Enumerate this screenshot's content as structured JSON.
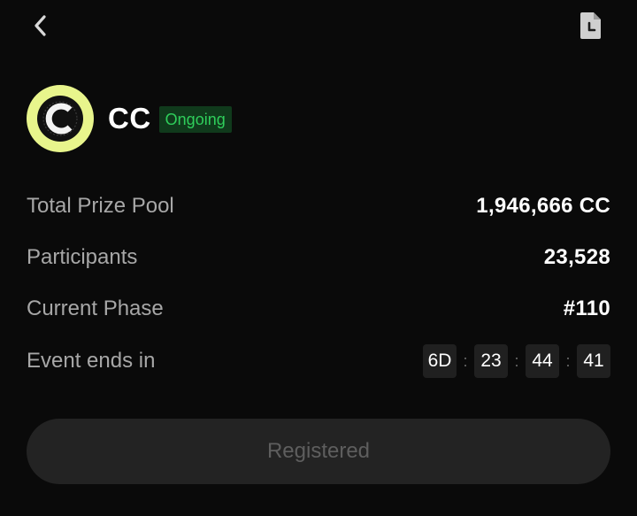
{
  "nav": {
    "back_icon": "chevron-left-icon",
    "history_icon": "document-clock-icon"
  },
  "token": {
    "name": "CC",
    "status": "Ongoing",
    "logo_letter": "C",
    "logo_color": "#e8f58c"
  },
  "info": {
    "prize_pool_label": "Total Prize Pool",
    "prize_pool_value": "1,946,666 CC",
    "participants_label": "Participants",
    "participants_value": "23,528",
    "phase_label": "Current Phase",
    "phase_value": "#110",
    "ends_label": "Event ends in"
  },
  "countdown": {
    "days": "6D",
    "hours": "23",
    "minutes": "44",
    "seconds": "41",
    "separator": ":"
  },
  "action": {
    "register_label": "Registered"
  },
  "colors": {
    "background": "#0a0a0a",
    "status_green": "#2fce5b",
    "status_bg": "#103a1c",
    "label_gray": "#a7a7a7"
  }
}
